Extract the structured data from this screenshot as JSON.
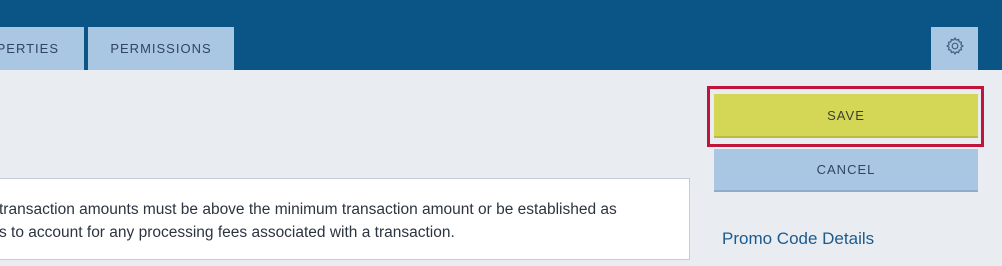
{
  "tabs": {
    "properties_label": "PERTIES",
    "permissions_label": "PERMISSIONS"
  },
  "toolbar": {
    "settings_icon": "gear-icon"
  },
  "actions": {
    "save_label": "SAVE",
    "cancel_label": "CANCEL"
  },
  "info": {
    "line1": "transaction amounts must be above the minimum transaction amount or be established as",
    "line2": "s to account for any processing fees associated with a transaction."
  },
  "sidebar": {
    "promo_link": "Promo Code Details"
  },
  "colors": {
    "header": "#0b5486",
    "tab": "#a9c6e3",
    "save": "#d4d756",
    "highlight": "#c1143a",
    "background": "#e9edf2"
  }
}
